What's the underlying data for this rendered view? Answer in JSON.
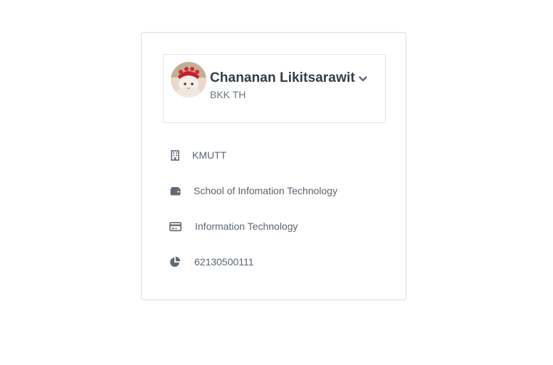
{
  "profile": {
    "name": "Chananan Likitsarawit",
    "location": "BKK TH",
    "avatar_icon": "cat-avatar",
    "menu_icon": "chevron-down-icon"
  },
  "details": [
    {
      "icon": "building-icon",
      "text": "KMUTT"
    },
    {
      "icon": "wallet-icon",
      "text": "School of Infomation Technology"
    },
    {
      "icon": "credit-card-icon",
      "text": "Information Technology"
    },
    {
      "icon": "pie-chart-icon",
      "text": "62130500111"
    }
  ],
  "colors": {
    "text": "#333d47",
    "muted": "#6b7580",
    "icon": "#5f6b76",
    "border": "#dcdcdc"
  }
}
